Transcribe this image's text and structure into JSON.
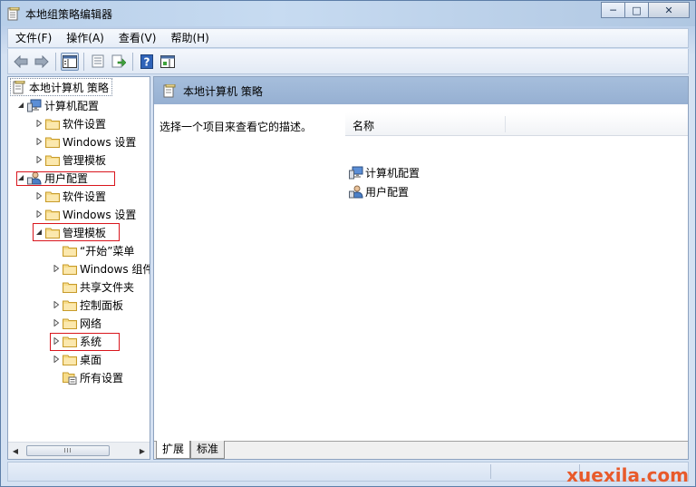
{
  "window": {
    "title": "本地组策略编辑器",
    "buttons": {
      "minimize": "─",
      "maximize": "□",
      "close": "✕"
    }
  },
  "menubar": {
    "items": [
      "文件(F)",
      "操作(A)",
      "查看(V)",
      "帮助(H)"
    ]
  },
  "toolbar": {
    "buttons": [
      {
        "name": "back-icon"
      },
      {
        "name": "forward-icon"
      },
      {
        "name": "show-hide-tree-icon"
      },
      {
        "name": "properties-icon"
      },
      {
        "name": "export-list-icon"
      },
      {
        "name": "help-icon"
      },
      {
        "name": "show-hide-action-pane-icon"
      }
    ]
  },
  "tree": {
    "root": "本地计算机 策略",
    "items": [
      {
        "label": "计算机配置",
        "level": 1,
        "expander": "expanded",
        "icon": "computer-icon"
      },
      {
        "label": "软件设置",
        "level": 2,
        "expander": "collapsed",
        "icon": "folder-icon"
      },
      {
        "label": "Windows 设置",
        "level": 2,
        "expander": "collapsed",
        "icon": "folder-icon"
      },
      {
        "label": "管理模板",
        "level": 2,
        "expander": "collapsed",
        "icon": "folder-icon"
      },
      {
        "label": "用户配置",
        "level": 1,
        "expander": "expanded",
        "icon": "user-icon"
      },
      {
        "label": "软件设置",
        "level": 2,
        "expander": "collapsed",
        "icon": "folder-icon"
      },
      {
        "label": "Windows 设置",
        "level": 2,
        "expander": "collapsed",
        "icon": "folder-icon"
      },
      {
        "label": "管理模板",
        "level": 2,
        "expander": "expanded",
        "icon": "folder-icon"
      },
      {
        "label": "“开始”菜单",
        "level": 3,
        "expander": "none",
        "icon": "folder-icon"
      },
      {
        "label": "Windows 组件",
        "level": 3,
        "expander": "collapsed",
        "icon": "folder-icon"
      },
      {
        "label": "共享文件夹",
        "level": 3,
        "expander": "none",
        "icon": "folder-icon"
      },
      {
        "label": "控制面板",
        "level": 3,
        "expander": "collapsed",
        "icon": "folder-icon"
      },
      {
        "label": "网络",
        "level": 3,
        "expander": "collapsed",
        "icon": "folder-icon"
      },
      {
        "label": "系统",
        "level": 3,
        "expander": "collapsed",
        "icon": "folder-icon"
      },
      {
        "label": "桌面",
        "level": 3,
        "expander": "collapsed",
        "icon": "folder-icon"
      },
      {
        "label": "所有设置",
        "level": 3,
        "expander": "none",
        "icon": "settings-page-icon"
      }
    ],
    "scrollbar_thumb": "III"
  },
  "detail": {
    "header_title": "本地计算机 策略",
    "description": "选择一个项目来查看它的描述。",
    "column_name": "名称",
    "items": [
      {
        "label": "计算机配置",
        "icon": "computer-icon"
      },
      {
        "label": "用户配置",
        "icon": "user-icon"
      }
    ],
    "tabs": [
      "扩展",
      "标准"
    ]
  },
  "colors": {
    "highlight_box": "#d9161d",
    "header_band": "#9fb8d8"
  },
  "watermark": "xuexila.com"
}
